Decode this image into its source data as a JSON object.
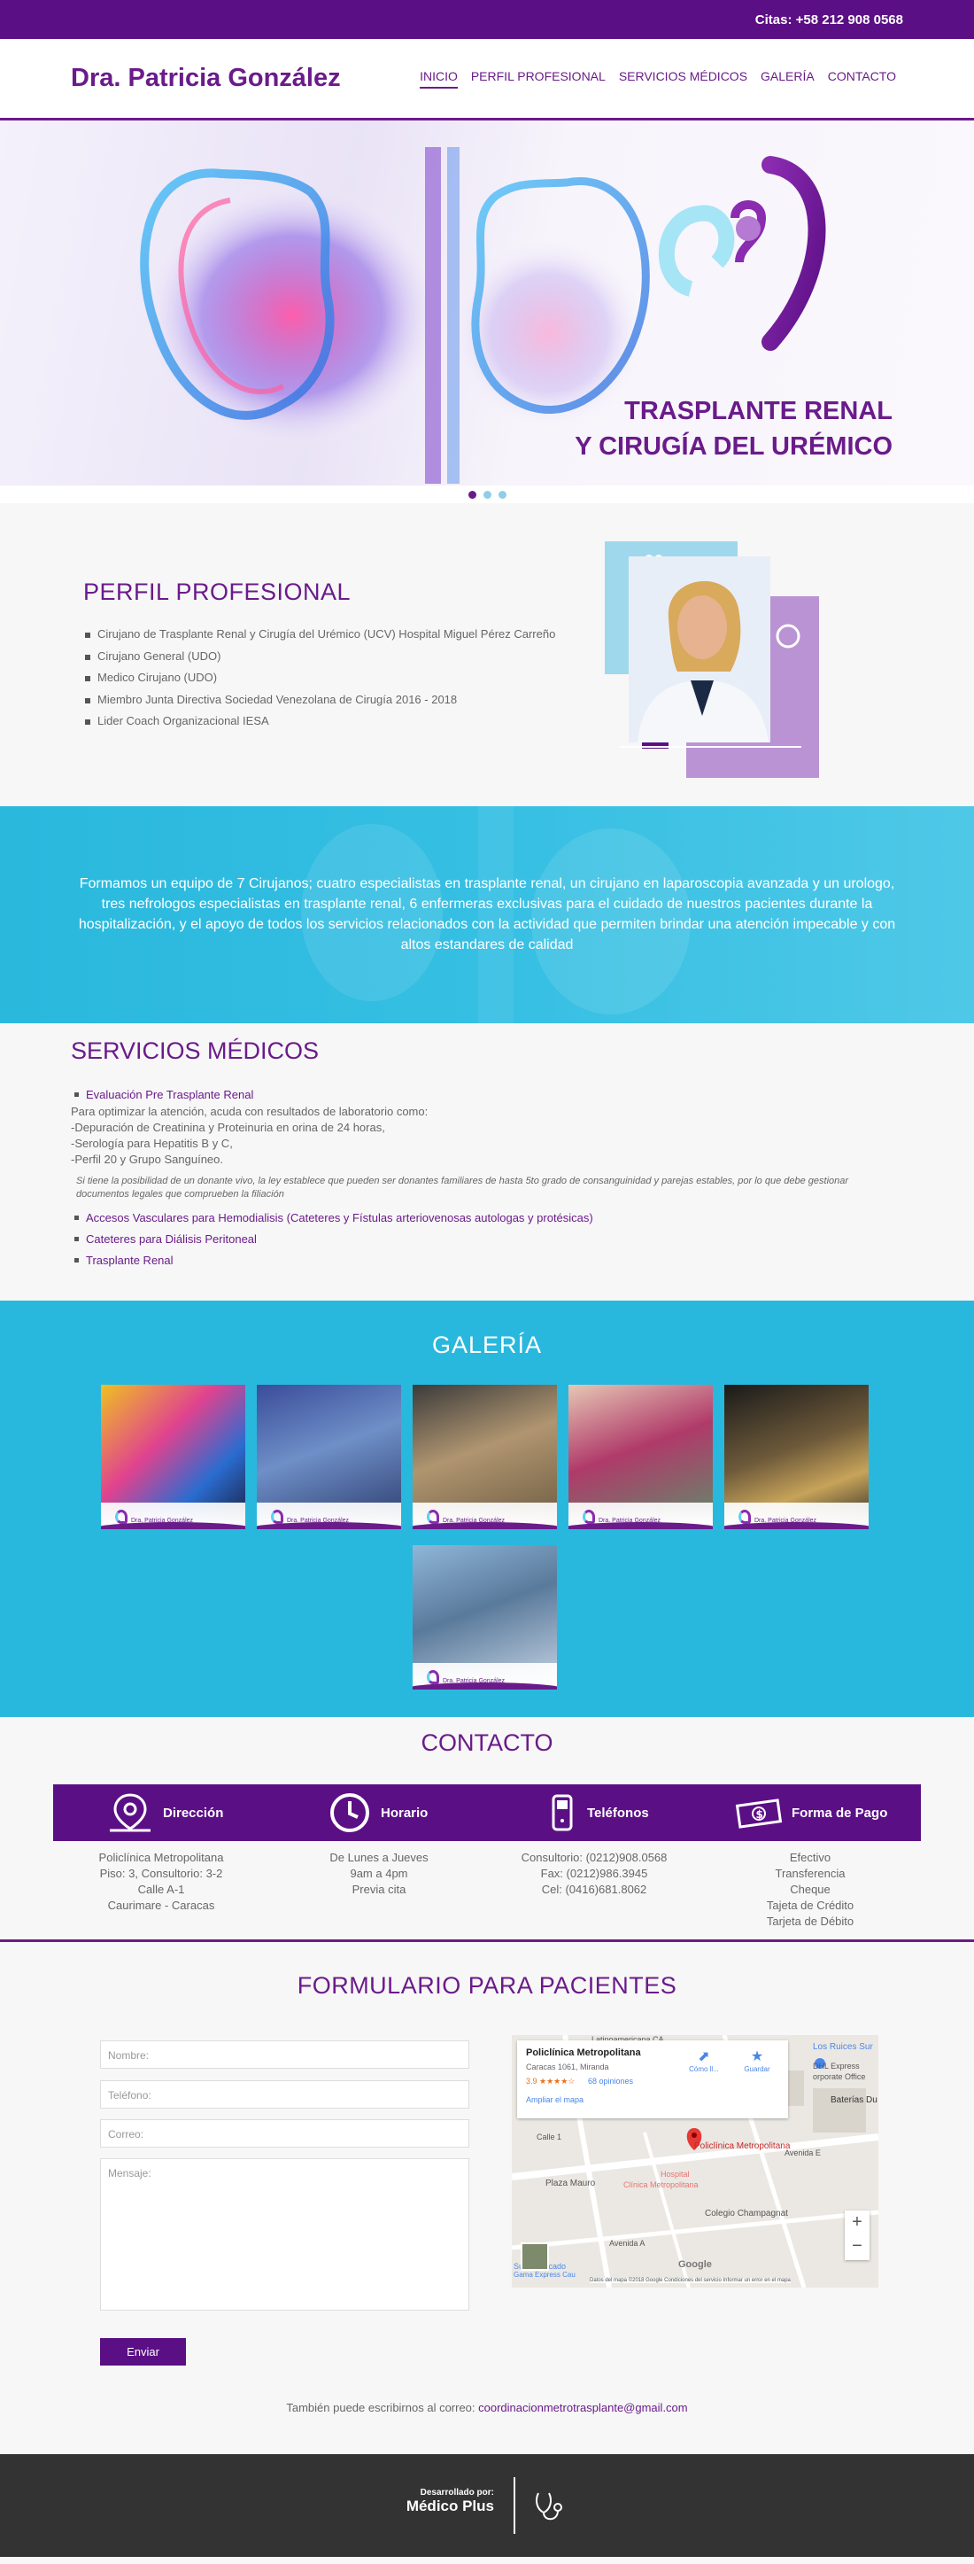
{
  "topbar": {
    "phone": "Citas: +58 212 908 0568"
  },
  "header": {
    "brand": "Dra. Patricia González",
    "nav": [
      "INICIO",
      "PERFIL PROFESIONAL",
      "SERVICIOS MÉDICOS",
      "GALERÍA",
      "CONTACTO"
    ]
  },
  "hero": {
    "title_line1": "TRASPLANTE RENAL",
    "title_line2": "Y CIRUGÍA DEL URÉMICO"
  },
  "perfil": {
    "title": "PERFIL PROFESIONAL",
    "items": [
      "Cirujano de Trasplante Renal y Cirugía del Urémico (UCV) Hospital Miguel Pérez Carreño",
      "Cirujano General (UDO)",
      "Medico Cirujano (UDO)",
      "Miembro Junta Directiva Sociedad Venezolana de Cirugía 2016 - 2018",
      "Lider Coach Organizacional IESA"
    ]
  },
  "banner": {
    "text": "Formamos un equipo de 7 Cirujanos; cuatro especialistas en trasplante renal, un cirujano en laparoscopia avanzada y un urologo, tres nefrologos especialistas en trasplante renal, 6 enfermeras exclusivas para el cuidado de nuestros pacientes durante la hospitalización, y el apoyo de todos los servicios relacionados con la actividad que permiten brindar una atención impecable y con altos estandares de calidad"
  },
  "servicios": {
    "title": "SERVICIOS MÉDICOS",
    "item1": "Evaluación Pre Trasplante Renal",
    "lines": [
      "Para optimizar la atención, acuda con resultados de laboratorio como:",
      "-Depuración de Creatinina y Proteinuria en orina de 24 horas,",
      "-Serología para Hepatitis B y C,",
      "-Perfil 20 y Grupo Sanguíneo."
    ],
    "note": "Si tiene la posibilidad de un donante vivo, la ley establece que pueden ser donantes familiares de hasta 5to grado de consanguinidad y parejas estables, por lo que debe gestionar documentos legales que comprueben la filiación",
    "item2": "Accesos Vasculares para Hemodialisis (Cateteres y Fístulas arteriovenosas autologas y protésicas)",
    "item3": "Cateteres para Diálisis Peritoneal",
    "item4": "Trasplante Renal"
  },
  "galeria": {
    "title": "GALERÍA",
    "watermark": "Dra. Patricia González"
  },
  "contacto": {
    "title": "CONTACTO",
    "cols": [
      {
        "label": "Dirección",
        "icon": "map-pin-icon",
        "lines": [
          "Policlínica Metropolitana",
          "Piso: 3, Consultorio: 3-2",
          "Calle A-1",
          "Caurimare - Caracas"
        ]
      },
      {
        "label": "Horario",
        "icon": "clock-icon",
        "lines": [
          "De Lunes a Jueves",
          "9am a 4pm",
          "Previa cita"
        ]
      },
      {
        "label": "Teléfonos",
        "icon": "phone-icon",
        "lines": [
          "Consultorio: (0212)908.0568",
          "Fax: (0212)986.3945",
          "Cel: (0416)681.8062"
        ]
      },
      {
        "label": "Forma de Pago",
        "icon": "money-icon",
        "lines": [
          "Efectivo",
          "Transferencia",
          "Cheque",
          "Tajeta de Crédito",
          "Tarjeta de Débito"
        ]
      }
    ]
  },
  "formulario": {
    "title": "FORMULARIO PARA PACIENTES",
    "nombre": "Nombre:",
    "telefono": "Teléfono:",
    "correo": "Correo:",
    "mensaje": "Mensaje:",
    "submit": "Enviar",
    "email_prefix": "También puede escribirnos al correo: ",
    "email": "coordinacionmetrotrasplante@gmail.com"
  },
  "map": {
    "place": "Policlínica Metropolitana",
    "address": "Caracas 1061, Miranda",
    "rating": "3.9 ★★★★☆",
    "reviews": "68 opiniones",
    "enlarge": "Ampliar el mapa",
    "directions": "Cómo ll...",
    "save": "Guardar",
    "marker": "Policlínica Metropolitana",
    "labels": [
      "Latinoamericana CA",
      "Los Ruices Sur",
      "DHL Express",
      "orporate Office",
      "Baterías Du",
      "Avenida E",
      "Hospital",
      "Clínica Metropolitana",
      "Plaza Mauro",
      "Colegio Champagnat",
      "Supermercado",
      "Gama Express Cau",
      "Calle 1",
      "Avenida A"
    ],
    "attribution": "Datos del mapa ©2018 Google   Condiciones del servicio   Informar un error en el mapa",
    "google": "Google"
  },
  "footer": {
    "dev_label": "Desarrollado por:",
    "dev_name": "Médico Plus"
  },
  "colors": {
    "purple": "#5b0f85",
    "brand": "#6a1b8a",
    "cyan": "#29b8dd"
  }
}
